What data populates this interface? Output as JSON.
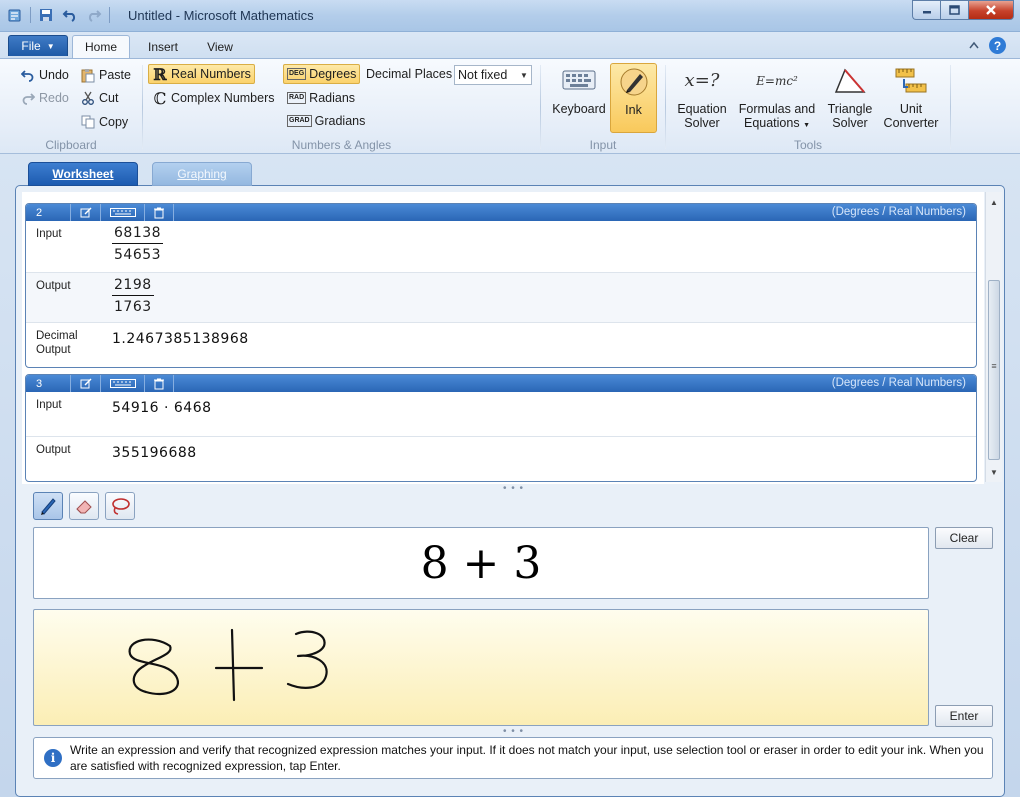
{
  "window": {
    "title": "Untitled - Microsoft Mathematics"
  },
  "ribbon_tabs": {
    "file": "File",
    "home": "Home",
    "insert": "Insert",
    "view": "View"
  },
  "clipboard": {
    "undo": "Undo",
    "redo": "Redo",
    "paste": "Paste",
    "cut": "Cut",
    "copy": "Copy",
    "label": "Clipboard"
  },
  "numbers_angles": {
    "real_numbers": "Real Numbers",
    "complex_numbers": "Complex Numbers",
    "deg_tag": "DEG",
    "rad_tag": "RAD",
    "grad_tag": "GRAD",
    "degrees": "Degrees",
    "radians": "Radians",
    "gradians": "Gradians",
    "decimal_places_label": "Decimal Places",
    "decimal_places_value": "Not fixed",
    "label": "Numbers & Angles"
  },
  "input_group": {
    "keyboard": "Keyboard",
    "ink": "Ink",
    "label": "Input"
  },
  "tools": {
    "equation_solver_l1": "Equation",
    "equation_solver_l2": "Solver",
    "formulas_l1": "Formulas and",
    "formulas_l2": "Equations",
    "triangle_l1": "Triangle",
    "triangle_l2": "Solver",
    "unit_l1": "Unit",
    "unit_l2": "Converter",
    "label": "Tools",
    "eq_glyph": "x=?",
    "formula_glyph": "E=mc²"
  },
  "worksheet_tabs": {
    "worksheet": "Worksheet",
    "graphing": "Graphing"
  },
  "entries": [
    {
      "number": "2",
      "mode": "(Degrees / Real Numbers)",
      "input_label": "Input",
      "input_num": "68138",
      "input_den": "54653",
      "output_label": "Output",
      "output_num": "2198",
      "output_den": "1763",
      "decimal_label_l1": "Decimal",
      "decimal_label_l2": "Output",
      "decimal_value": "1.2467385138968"
    },
    {
      "number": "3",
      "mode": "(Degrees / Real Numbers)",
      "input_label": "Input",
      "input_value": "54916 · 6468",
      "output_label": "Output",
      "output_value": "355196688"
    }
  ],
  "ink_panel": {
    "recognized": "8 + 3",
    "clear": "Clear",
    "enter": "Enter",
    "info_text": "Write an expression and verify that recognized expression matches your input. If it does not match your input, use selection tool or eraser in order to edit your ink. When you are satisfied with recognized expression, tap Enter."
  },
  "colors": {
    "accent": "#2a66b5",
    "selected_fill": "#fbd26c",
    "ink_pad": "#fbeeb5"
  }
}
